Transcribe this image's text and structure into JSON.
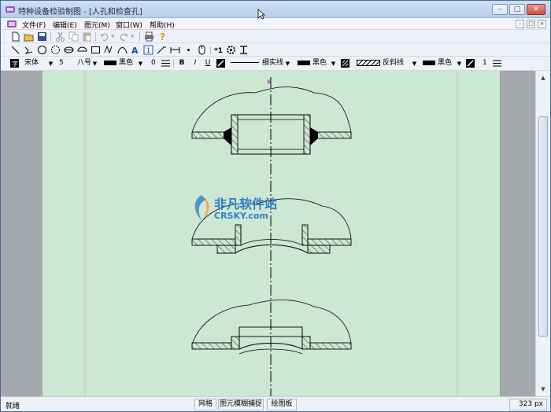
{
  "window": {
    "title": "特种设备检验制图 - [人孔和检查孔]",
    "controls": {
      "minimize": "–",
      "maximize": "□",
      "close": "✕"
    }
  },
  "menu": {
    "items": [
      "文件(F)",
      "编辑(E)",
      "图元(M)",
      "窗口(W)",
      "帮助(H)"
    ],
    "mdi_controls": [
      "–",
      "□",
      "×"
    ]
  },
  "toolbar1": {
    "icons": [
      "new-icon",
      "open-icon",
      "save-icon",
      "cut-icon",
      "copy-icon",
      "paste-icon",
      "undo-icon",
      "redo-icon",
      "print-icon",
      "help-icon"
    ]
  },
  "toolbar2": {
    "icons": [
      "line-icon",
      "polyline-icon",
      "circle-icon",
      "arc-icon",
      "ellipse-icon",
      "half-ellipse-icon",
      "rectangle-icon",
      "curve-icon",
      "spline-icon",
      "text-icon",
      "number-icon",
      "leader-icon",
      "dimension-icon",
      "point-icon",
      "mouse-icon",
      "symbol-icon",
      "gear-icon",
      "tolerance-icon"
    ]
  },
  "toolbar3": {
    "font_name": "宋体",
    "font_size": "5",
    "char_size": "八号",
    "text_color": "黑色",
    "spacing": "0",
    "bold": "B",
    "italic": "I",
    "underline": "U",
    "line_type": "细实线",
    "line_color": "黑色",
    "hatch_type": "反斜线",
    "hatch_color": "黑色",
    "hatch_scale": "1"
  },
  "status": {
    "ready": "就绪",
    "grid": "网格",
    "snap": "图元模糊捕捉",
    "board": "绘图板",
    "coord": "323 px"
  },
  "watermark": {
    "line1": "非凡软件站",
    "line2": "CRSKY.com"
  },
  "colors": {
    "sheet": "#cce7d2",
    "outside": "#a5a8ac",
    "centerline": "#000000",
    "marker": "#a020a0"
  }
}
